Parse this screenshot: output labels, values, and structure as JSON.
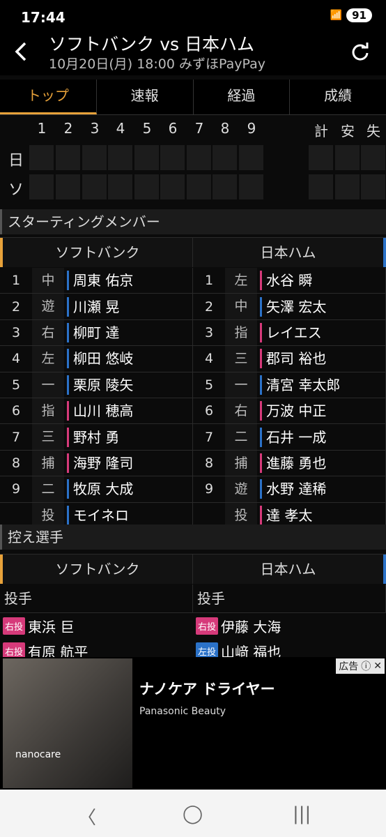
{
  "status": {
    "time": "17:44",
    "battery": "91"
  },
  "header": {
    "title": "ソフトバンク vs 日本ハム",
    "subtitle": "10月20日(月) 18:00 みずほPayPay"
  },
  "tabs": [
    "トップ",
    "速報",
    "経過",
    "成績"
  ],
  "scoreboard": {
    "innings": [
      "1",
      "2",
      "3",
      "4",
      "5",
      "6",
      "7",
      "8",
      "9"
    ],
    "totals": [
      "計",
      "安",
      "失"
    ],
    "teams": [
      "日",
      "ソ"
    ]
  },
  "starting": {
    "heading": "スターティングメンバー",
    "home_team": "ソフトバンク",
    "away_team": "日本ハム",
    "home": [
      {
        "order": "1",
        "pos": "中",
        "name": "周東 佑京",
        "bat": "L"
      },
      {
        "order": "2",
        "pos": "遊",
        "name": "川瀬 晃",
        "bat": "L"
      },
      {
        "order": "3",
        "pos": "右",
        "name": "柳町 達",
        "bat": "L"
      },
      {
        "order": "4",
        "pos": "左",
        "name": "柳田 悠岐",
        "bat": "L"
      },
      {
        "order": "5",
        "pos": "一",
        "name": "栗原 陵矢",
        "bat": "L"
      },
      {
        "order": "6",
        "pos": "指",
        "name": "山川 穂高",
        "bat": "R"
      },
      {
        "order": "7",
        "pos": "三",
        "name": "野村 勇",
        "bat": "R"
      },
      {
        "order": "8",
        "pos": "捕",
        "name": "海野 隆司",
        "bat": "R"
      },
      {
        "order": "9",
        "pos": "二",
        "name": "牧原 大成",
        "bat": "L"
      },
      {
        "order": "",
        "pos": "投",
        "name": "モイネロ",
        "bat": "L"
      }
    ],
    "away": [
      {
        "order": "1",
        "pos": "左",
        "name": "水谷 瞬",
        "bat": "R"
      },
      {
        "order": "2",
        "pos": "中",
        "name": "矢澤 宏太",
        "bat": "L"
      },
      {
        "order": "3",
        "pos": "指",
        "name": "レイエス",
        "bat": "R"
      },
      {
        "order": "4",
        "pos": "三",
        "name": "郡司 裕也",
        "bat": "R"
      },
      {
        "order": "5",
        "pos": "一",
        "name": "清宮 幸太郎",
        "bat": "L"
      },
      {
        "order": "6",
        "pos": "右",
        "name": "万波 中正",
        "bat": "R"
      },
      {
        "order": "7",
        "pos": "二",
        "name": "石井 一成",
        "bat": "L"
      },
      {
        "order": "8",
        "pos": "捕",
        "name": "進藤 勇也",
        "bat": "R"
      },
      {
        "order": "9",
        "pos": "遊",
        "name": "水野 達稀",
        "bat": "L"
      },
      {
        "order": "",
        "pos": "投",
        "name": "達 孝太",
        "bat": "R"
      }
    ]
  },
  "bench": {
    "heading": "控え選手",
    "home_team": "ソフトバンク",
    "away_team": "日本ハム",
    "category": "投手",
    "home": [
      {
        "badge": "右投",
        "name": "東浜 巨"
      },
      {
        "badge": "右投",
        "name": "有原 航平"
      }
    ],
    "away": [
      {
        "badge": "右投",
        "name": "伊藤 大海"
      },
      {
        "badge": "左投",
        "name": "山﨑 福也"
      }
    ]
  },
  "ad": {
    "title": "ナノケア ドライヤー",
    "sponsor": "Panasonic Beauty",
    "label": "広告",
    "img_text": "nanocare"
  },
  "colors": {
    "accent": "#e8a23a",
    "blue": "#2b72c8",
    "pink": "#d63a7a"
  }
}
